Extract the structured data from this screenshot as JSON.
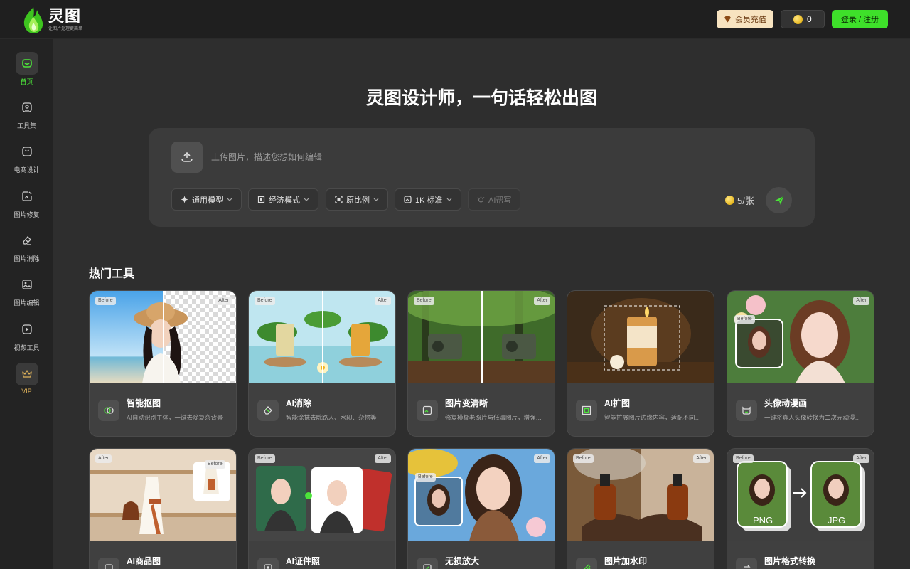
{
  "brand": {
    "name": "灵图",
    "tagline": "让图片处理更简单",
    "accent": "#3ee02a"
  },
  "header": {
    "vip_label": "会员充值",
    "coin_count": "0",
    "login_label": "登录 / 注册"
  },
  "sidebar": {
    "items": [
      {
        "label": "首页",
        "icon": "home-icon",
        "active": true
      },
      {
        "label": "工具集",
        "icon": "toolbox-icon"
      },
      {
        "label": "电商设计",
        "icon": "shopping-bag-icon"
      },
      {
        "label": "图片修复",
        "icon": "image-repair-icon"
      },
      {
        "label": "图片消除",
        "icon": "eraser-icon"
      },
      {
        "label": "图片编辑",
        "icon": "image-edit-icon"
      },
      {
        "label": "视频工具",
        "icon": "video-icon"
      },
      {
        "label": "VIP",
        "icon": "crown-icon"
      }
    ]
  },
  "hero": {
    "title": "灵图设计师，一句话轻松出图",
    "placeholder": "上传图片，描述您想如何编辑",
    "options": [
      {
        "label": "通用模型",
        "icon": "model-icon"
      },
      {
        "label": "经济模式",
        "icon": "mode-icon"
      },
      {
        "label": "原比例",
        "icon": "ratio-icon"
      },
      {
        "label": "1K 标准",
        "icon": "resolution-icon"
      },
      {
        "label": "AI帮写",
        "icon": "ai-write-icon"
      }
    ],
    "cost": "5/张"
  },
  "tools": {
    "title": "热门工具",
    "before_label": "Before",
    "after_label": "After",
    "cards": [
      {
        "title": "智能抠图",
        "desc": "AI自动识别主体，一键去除复杂背景"
      },
      {
        "title": "AI消除",
        "desc": "智能涂抹去除路人、水印、杂物等"
      },
      {
        "title": "图片变清晰",
        "desc": "修复模糊老照片与低清图片，增强细节"
      },
      {
        "title": "AI扩图",
        "desc": "智能扩展图片边缘内容，适配不同尺寸"
      },
      {
        "title": "头像动漫画",
        "desc": "一键将真人头像转换为二次元动漫风格"
      },
      {
        "title": "AI商品图",
        "desc": ""
      },
      {
        "title": "AI证件照",
        "desc": ""
      },
      {
        "title": "无损放大",
        "desc": ""
      },
      {
        "title": "图片加水印",
        "desc": ""
      },
      {
        "title": "图片格式转换",
        "desc": ""
      }
    ],
    "format_from": "PNG",
    "format_to": "JPG"
  }
}
